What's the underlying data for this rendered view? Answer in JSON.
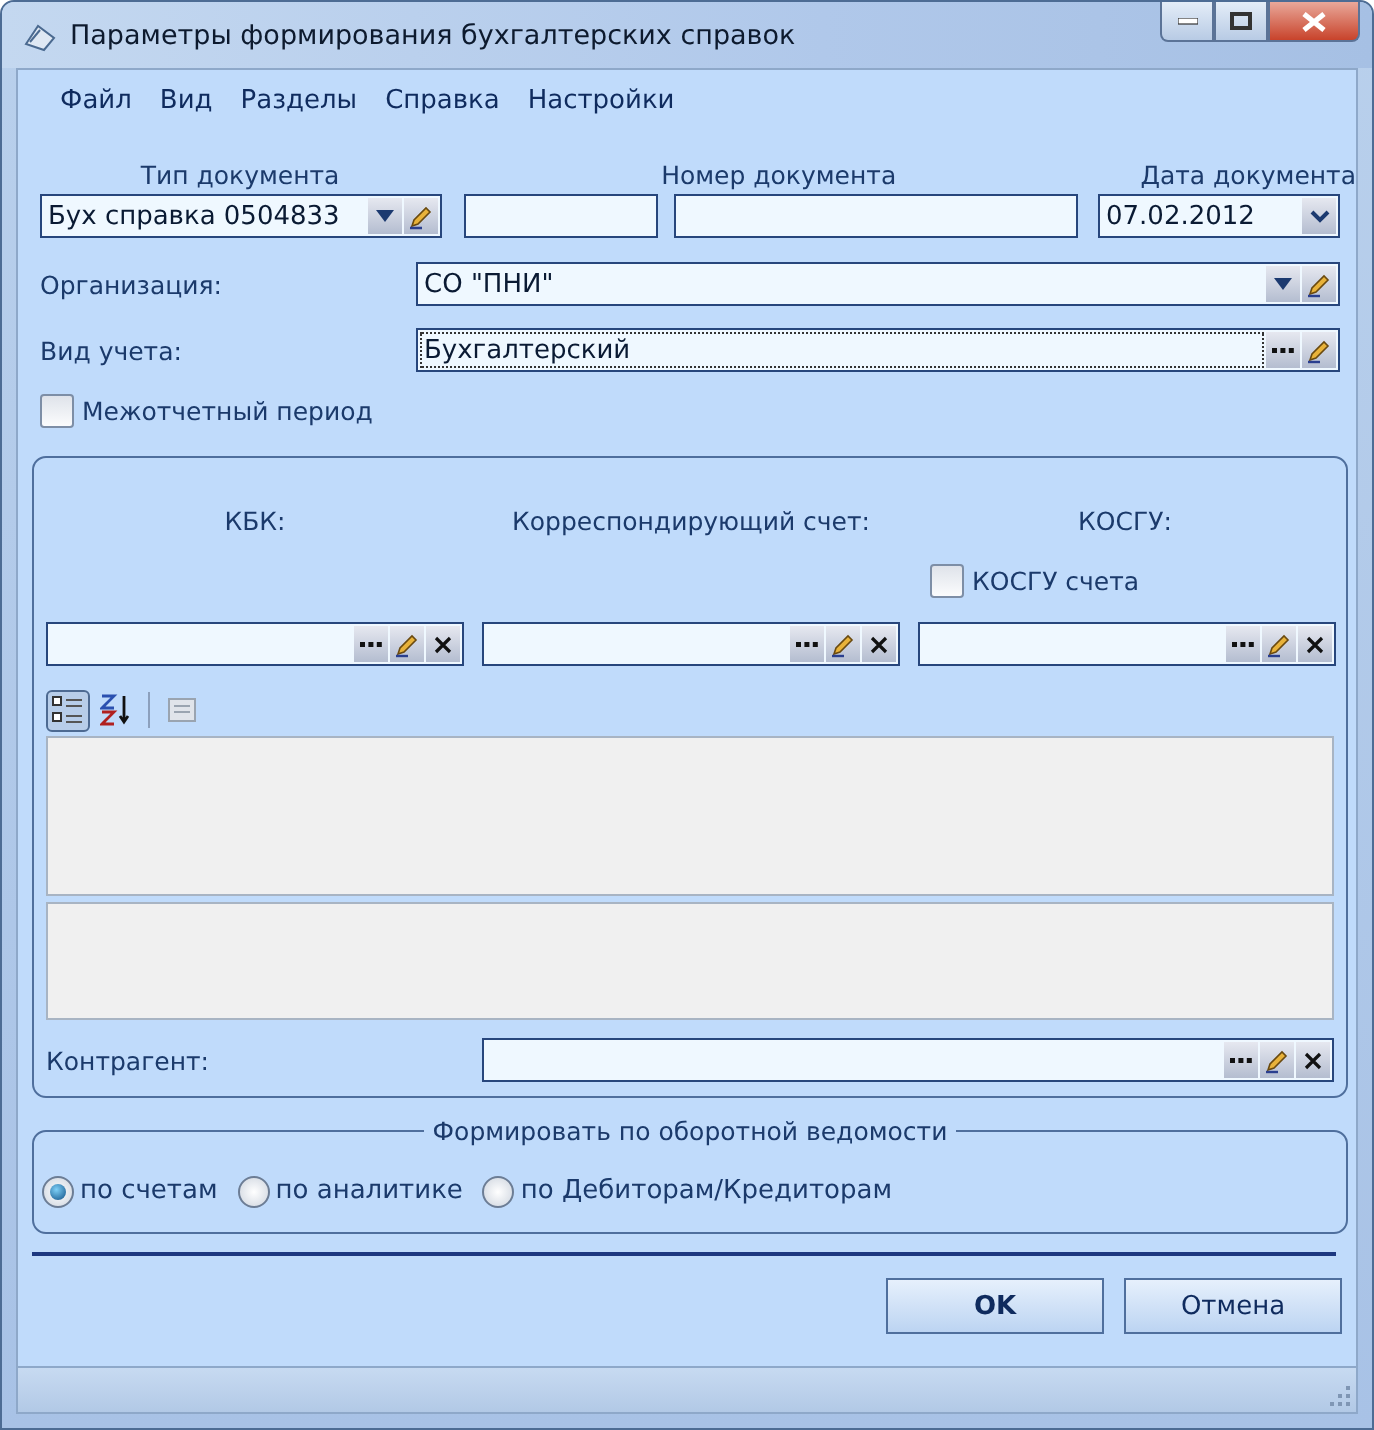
{
  "window": {
    "title": "Параметры формирования бухгалтерских справок"
  },
  "menu": [
    {
      "label": "Файл"
    },
    {
      "label": "Вид"
    },
    {
      "label": "Разделы"
    },
    {
      "label": "Справка"
    },
    {
      "label": "Настройки"
    }
  ],
  "doc_type": {
    "label": "Тип документа",
    "value": "Бух справка 0504833"
  },
  "doc_number": {
    "label": "Номер документа"
  },
  "doc_date": {
    "label": "Дата документа",
    "value": "07.02.2012"
  },
  "organization": {
    "label": "Организация:",
    "value": "СО \"ПНИ\""
  },
  "account_type": {
    "label": "Вид учета:",
    "value": "Бухгалтерский"
  },
  "interperiod": {
    "label": "Межотчетный период",
    "checked": false
  },
  "filters": {
    "kbk_label": "КБК:",
    "corr_label": "Корреспондирующий счет:",
    "kosgu_label": "КОСГУ:",
    "kosgu_account": {
      "label": "КОСГУ счета",
      "checked": false
    }
  },
  "counterparty": {
    "label": "Контрагент:"
  },
  "build_mode": {
    "title": "Формировать по оборотной ведомости",
    "options": [
      {
        "label": "по счетам",
        "selected": true
      },
      {
        "label": "по аналитике",
        "selected": false
      },
      {
        "label": "по Дебиторам/Кредиторам",
        "selected": false
      }
    ]
  },
  "buttons": [
    {
      "label": "OK",
      "kind": "default"
    },
    {
      "label": "Отмена",
      "kind": "normal"
    }
  ]
}
